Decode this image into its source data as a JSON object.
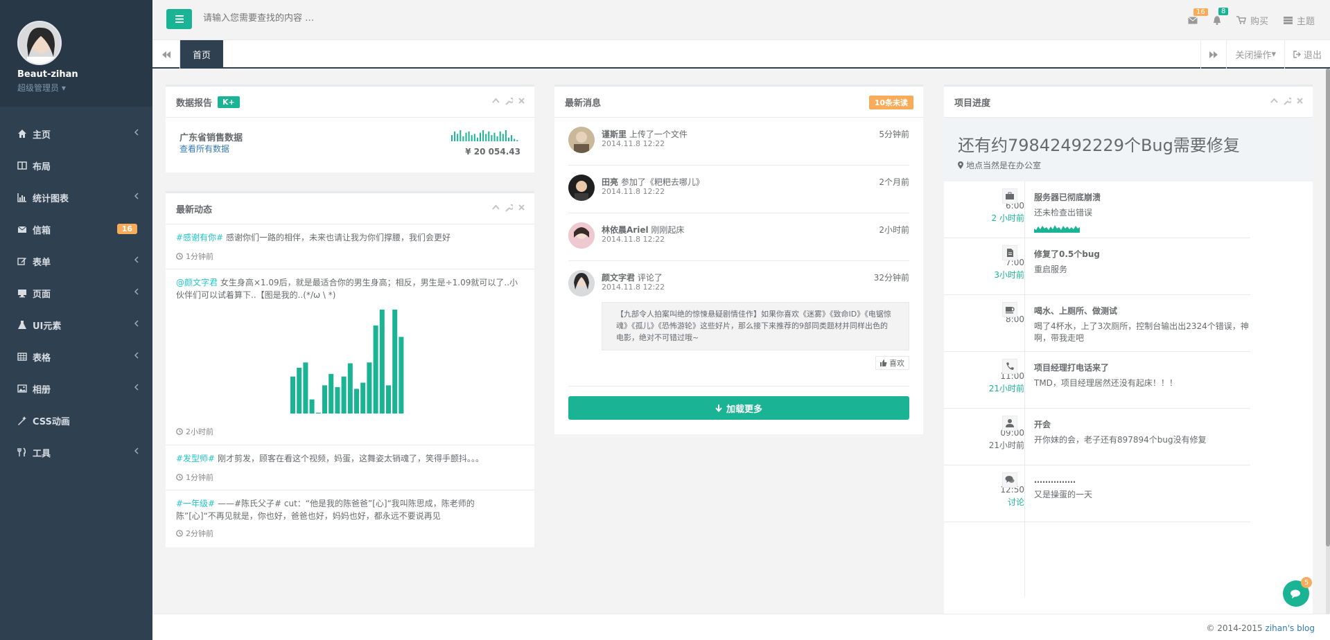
{
  "user": {
    "name": "Beaut-zihan",
    "role": "超级管理员"
  },
  "sidebar": {
    "items": [
      {
        "label": "主页",
        "icon": "home-icon",
        "chevron": true
      },
      {
        "label": "布局",
        "icon": "columns-icon",
        "chevron": false
      },
      {
        "label": "统计图表",
        "icon": "bar-chart-icon",
        "chevron": true
      },
      {
        "label": "信箱",
        "icon": "envelope-icon",
        "badge": "16"
      },
      {
        "label": "表单",
        "icon": "edit-icon",
        "chevron": true
      },
      {
        "label": "页面",
        "icon": "desktop-icon",
        "chevron": true
      },
      {
        "label": "UI元素",
        "icon": "flask-icon",
        "chevron": true
      },
      {
        "label": "表格",
        "icon": "table-icon",
        "chevron": true
      },
      {
        "label": "相册",
        "icon": "picture-icon",
        "chevron": true
      },
      {
        "label": "CSS动画",
        "icon": "magic-icon",
        "chevron": false
      },
      {
        "label": "工具",
        "icon": "cutlery-icon",
        "chevron": true
      }
    ]
  },
  "topbar": {
    "search_placeholder": "请输入您需要查找的内容 …",
    "mail_count": "16",
    "bell_count": "8",
    "buy_label": "购买",
    "theme_label": "主题"
  },
  "tabs": {
    "active": "首页",
    "close_ops": "关闭操作",
    "logout": "退出"
  },
  "data_report": {
    "title": "数据报告",
    "badge": "K+",
    "heading": "广东省销售数据",
    "link": "查看所有数据",
    "amount": "¥ 20 054.43",
    "sparkline": [
      5,
      8,
      6,
      9,
      4,
      7,
      8,
      5,
      6,
      3,
      7,
      9,
      6,
      8,
      5,
      7,
      4,
      8,
      6,
      9,
      3,
      5,
      2,
      1
    ]
  },
  "feed": {
    "title": "最新动态",
    "items": [
      {
        "tag": "#感谢有你#",
        "text": " 感谢你们一路的相伴，未来也请让我为你们撑腰，我们会更好",
        "time": "1分钟前"
      },
      {
        "tag": "@颜文字君",
        "text": " 女生身高×1.09后，就是最适合你的男生身高；相反，男生是÷1.09就可以了..小伙伴们可以试着算下..【图是我的..(*/ω \\ *)",
        "time": "2小时前"
      },
      {
        "tag": "#发型师#",
        "text": " 刚才剪发，顾客在看这个视频，妈蛋，这舞姿太销魂了，笑得手颤抖。。。",
        "time": "1分钟前"
      },
      {
        "tag": "#一年级#",
        "text": " ——#陈氏父子# cut：“他是我的陈爸爸”[心]“我叫陈思成，陈老师的陈”[心]“不再见就是，你也好，爸爸也好，妈妈也好，都永远不要说再见",
        "time": "2分钟前"
      }
    ],
    "bars": [
      42,
      52,
      58,
      16,
      1,
      32,
      45,
      30,
      42,
      57,
      28,
      35,
      58,
      100,
      118,
      32,
      118,
      87
    ]
  },
  "messages": {
    "title": "最新消息",
    "badge": "10条未读",
    "items": [
      {
        "name": "谨斯里",
        "action": " 上传了一个文件",
        "time": "5分钟前",
        "date": "2014.11.8 12:22"
      },
      {
        "name": "田亮",
        "action": " 参加了《粑粑去哪儿》",
        "time": "2个月前",
        "date": "2014.11.8 12:22"
      },
      {
        "name": "林依晨Ariel",
        "action": " 刚刚起床",
        "time": "2小时前",
        "date": "2014.11.8 12:22"
      },
      {
        "name": "颜文字君",
        "action": " 评论了",
        "time": "32分钟前",
        "date": "2014.11.8 12:22"
      }
    ],
    "quote": "【九部令人拍案叫绝的惊悚悬疑剧情佳作】如果你喜欢《迷雾》《致命ID》《电锯惊魂》《孤儿》《恐怖游轮》这些好片，那么接下来推荐的9部同类题材并同样出色的电影，绝对不可错过哦~",
    "like": "喜欢",
    "load_more": "加载更多"
  },
  "progress": {
    "title": "项目进度",
    "heading": "还有约79842492229个Bug需要修复",
    "location": "地点当然是在办公室",
    "timeline": [
      {
        "time": "6:00",
        "ago": "2 小时前",
        "title": "服务器已彻底崩溃",
        "text": "还未检查出错误",
        "icon": "briefcase-icon",
        "spark": true
      },
      {
        "time": "7:00",
        "ago": "3小时前",
        "title": "修复了0.5个bug",
        "text": "重启服务",
        "icon": "file-icon"
      },
      {
        "time": "8:00",
        "ago": "",
        "title": "喝水、上厕所、做测试",
        "text": "喝了4杯水，上了3次厕所，控制台输出出2324个错误，神啊，带我走吧",
        "icon": "coffee-icon"
      },
      {
        "time": "11:00",
        "ago": "21小时前",
        "title": "项目经理打电话来了",
        "text": "TMD，项目经理居然还没有起床！！！",
        "icon": "phone-icon"
      },
      {
        "time": "09:00",
        "ago": "21小时前",
        "title": "开会",
        "text": "开你妹的会，老子还有897894个bug没有修复",
        "icon": "user-md-icon",
        "gray": true
      },
      {
        "time": "12:50",
        "ago": "讨论",
        "title": "……………",
        "text": "又是操蛋的一天",
        "icon": "comments-icon"
      }
    ]
  },
  "footer": {
    "copy": "© 2014-2015 ",
    "link": "zihan's blog"
  },
  "chat": {
    "badge": "5"
  }
}
